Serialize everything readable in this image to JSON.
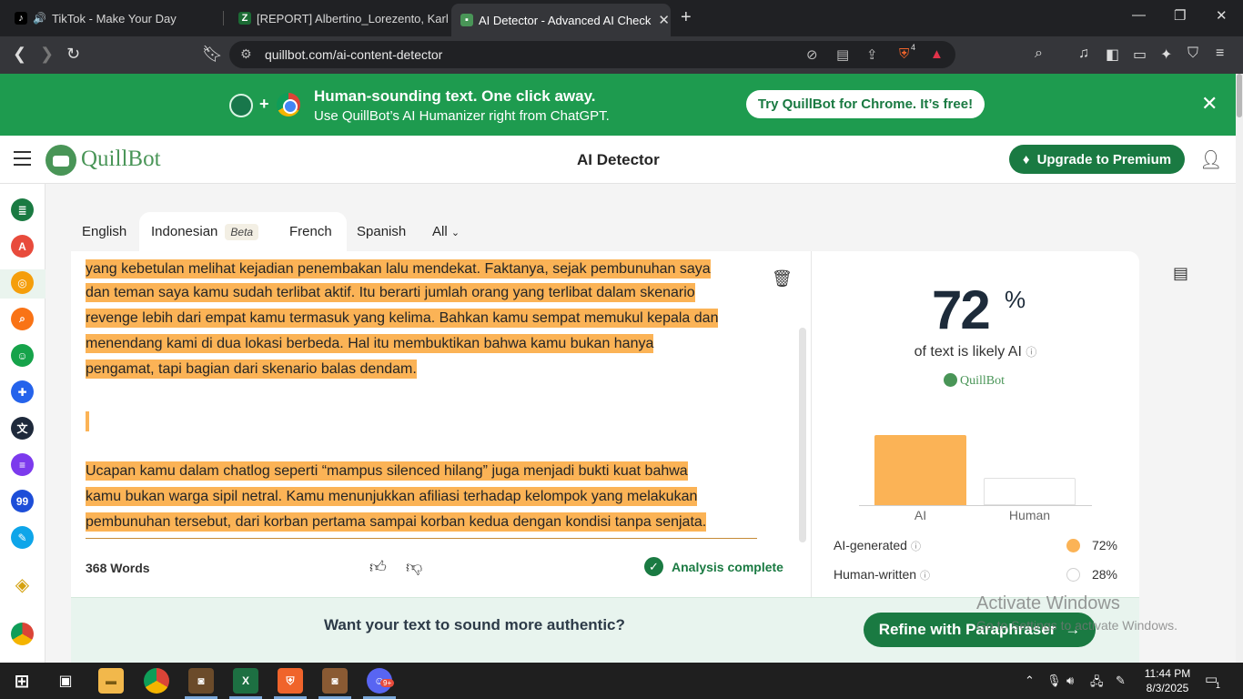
{
  "browser": {
    "tabs": [
      {
        "title": "TikTok - Make Your Day"
      },
      {
        "title": "[REPORT] Albertino_Lorezento, Karl_M"
      },
      {
        "title": "AI Detector - Advanced AI Check"
      }
    ],
    "url": "quillbot.com/ai-content-detector",
    "shield_count": "4"
  },
  "promo": {
    "headline": "Human-sounding text. One click away.",
    "subline": "Use QuillBot’s AI Humanizer right from ChatGPT.",
    "cta": "Try QuillBot for Chrome. It’s free!"
  },
  "header": {
    "logo": "QuillBot",
    "title": "AI Detector",
    "upgrade": "Upgrade to Premium"
  },
  "languages": {
    "items": [
      "English",
      "Indonesian",
      "French",
      "Spanish",
      "All"
    ],
    "beta": "Beta"
  },
  "editor": {
    "lines": [
      "yang kebetulan melihat kejadian penembakan lalu mendekat. Faktanya, sejak pembunuhan saya",
      "dan teman saya kamu sudah terlibat aktif. Itu berarti jumlah orang yang terlibat dalam skenario",
      "revenge lebih dari empat kamu termasuk yang kelima. Bahkan kamu sempat memukul kepala dan",
      "menendang kami di dua lokasi berbeda. Hal itu membuktikan bahwa kamu bukan hanya",
      "pengamat, tapi bagian dari skenario balas dendam.",
      "Ucapan kamu dalam chatlog seperti “mampus silenced hilang” juga menjadi bukti kuat bahwa",
      "kamu bukan warga sipil netral. Kamu menunjukkan afiliasi terhadap kelompok yang melakukan",
      "pembunuhan tersebut, dari korban pertama sampai korban kedua dengan kondisi tanpa senjata."
    ],
    "word_count": "368 Words",
    "status": "Analysis complete"
  },
  "result": {
    "score": "72",
    "score_suffix": "%",
    "caption": "of text is likely AI",
    "brand": "QuillBot",
    "ai_label": "AI",
    "human_label": "Human",
    "ai_fraction": 0.72,
    "human_fraction": 0.28,
    "ai_generated_label": "AI-generated",
    "ai_generated_value": "72%",
    "human_written_label": "Human-written",
    "human_written_value": "28%",
    "colors": {
      "ai": "#fbb356",
      "human": "#ffffff"
    }
  },
  "bottom": {
    "prompt": "Want your text to sound more authentic?",
    "cta": "Refine with Paraphraser"
  },
  "watermark": {
    "title": "Activate Windows",
    "subtitle": "Go to Settings to activate Windows."
  },
  "taskbar": {
    "time": "11:44 PM",
    "date": "8/3/2025",
    "notifications": "1",
    "discord_badge": "9+"
  }
}
